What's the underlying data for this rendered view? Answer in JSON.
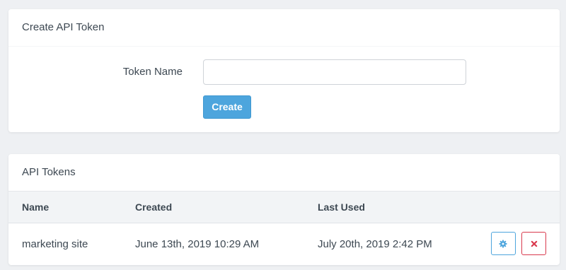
{
  "create_panel": {
    "title": "Create API Token",
    "token_name_label": "Token Name",
    "token_name_value": "",
    "token_name_placeholder": "",
    "create_button_label": "Create"
  },
  "tokens_panel": {
    "title": "API Tokens",
    "columns": [
      "Name",
      "Created",
      "Last Used"
    ],
    "rows": [
      {
        "name": "marketing site",
        "created": "June 13th, 2019 10:29 AM",
        "last_used": "July 20th, 2019 2:42 PM",
        "actions": [
          "gear-icon",
          "close-icon"
        ]
      }
    ]
  },
  "colors": {
    "background": "#eef0f3",
    "accent": "#4da5dd",
    "danger": "#d9394d",
    "text": "#3d4852",
    "table_header_bg": "#f2f4f6"
  }
}
